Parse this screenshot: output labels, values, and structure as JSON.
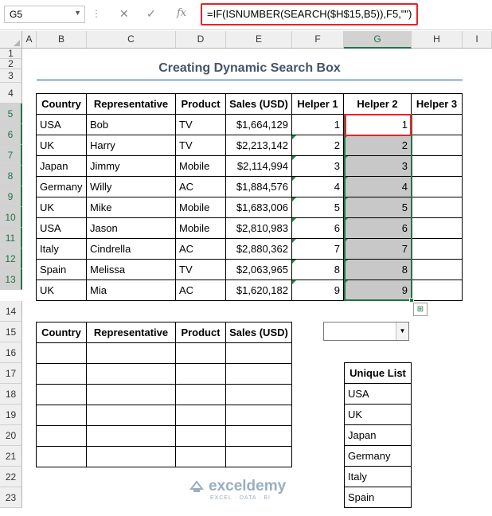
{
  "formula_bar": {
    "cell_name": "G5",
    "formula": "=IF(ISNUMBER(SEARCH($H$15,B5)),F5,\"\")",
    "fx_label": "fx"
  },
  "columns": [
    "A",
    "B",
    "C",
    "D",
    "E",
    "F",
    "G",
    "H",
    "I"
  ],
  "rows": [
    "1",
    "2",
    "3",
    "4",
    "5",
    "6",
    "7",
    "8",
    "9",
    "10",
    "11",
    "12",
    "13",
    "14",
    "15",
    "16",
    "17",
    "18",
    "19",
    "20",
    "21",
    "22",
    "23"
  ],
  "title": "Creating Dynamic Search Box",
  "main_table": {
    "headers": [
      "Country",
      "Representative",
      "Product",
      "Sales (USD)",
      "Helper 1",
      "Helper 2",
      "Helper 3"
    ],
    "rows": [
      [
        "USA",
        "Bob",
        "TV",
        "$1,664,129",
        "1",
        "1",
        ""
      ],
      [
        "UK",
        "Harry",
        "TV",
        "$2,213,142",
        "2",
        "2",
        ""
      ],
      [
        "Japan",
        "Jimmy",
        "Mobile",
        "$2,114,994",
        "3",
        "3",
        ""
      ],
      [
        "Germany",
        "Willy",
        "AC",
        "$1,884,576",
        "4",
        "4",
        ""
      ],
      [
        "UK",
        "Mike",
        "Mobile",
        "$1,683,006",
        "5",
        "5",
        ""
      ],
      [
        "USA",
        "Jason",
        "Mobile",
        "$2,810,983",
        "6",
        "6",
        ""
      ],
      [
        "Italy",
        "Cindrella",
        "AC",
        "$2,880,362",
        "7",
        "7",
        ""
      ],
      [
        "Spain",
        "Melissa",
        "TV",
        "$2,063,965",
        "8",
        "8",
        ""
      ],
      [
        "UK",
        "Mia",
        "AC",
        "$1,620,182",
        "9",
        "9",
        ""
      ]
    ]
  },
  "result_table": {
    "headers": [
      "Country",
      "Representative",
      "Product",
      "Sales (USD)"
    ]
  },
  "dropdown": {
    "selected": ""
  },
  "unique_list": {
    "header": "Unique List",
    "items": [
      "USA",
      "UK",
      "Japan",
      "Germany",
      "Italy",
      "Spain"
    ]
  },
  "watermark": {
    "name": "exceldemy",
    "tagline": "EXCEL · DATA · BI"
  },
  "colors": {
    "selection": "#217346",
    "highlight_red": "#e8222a",
    "title": "#44546a"
  }
}
